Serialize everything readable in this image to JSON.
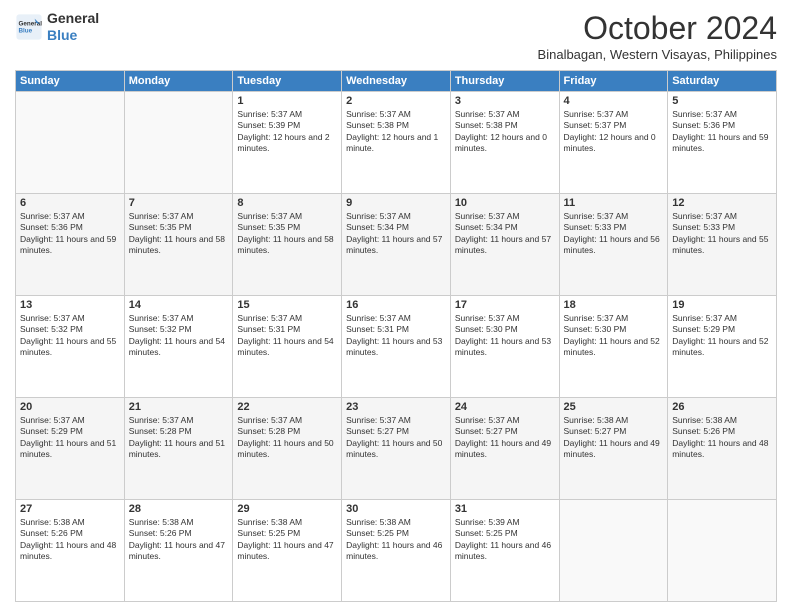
{
  "logo": {
    "line1": "General",
    "line2": "Blue"
  },
  "title": "October 2024",
  "location": "Binalbagan, Western Visayas, Philippines",
  "days_header": [
    "Sunday",
    "Monday",
    "Tuesday",
    "Wednesday",
    "Thursday",
    "Friday",
    "Saturday"
  ],
  "weeks": [
    [
      {
        "day": "",
        "info": ""
      },
      {
        "day": "",
        "info": ""
      },
      {
        "day": "1",
        "sunrise": "5:37 AM",
        "sunset": "5:39 PM",
        "daylight": "12 hours and 2 minutes."
      },
      {
        "day": "2",
        "sunrise": "5:37 AM",
        "sunset": "5:38 PM",
        "daylight": "12 hours and 1 minute."
      },
      {
        "day": "3",
        "sunrise": "5:37 AM",
        "sunset": "5:38 PM",
        "daylight": "12 hours and 0 minutes."
      },
      {
        "day": "4",
        "sunrise": "5:37 AM",
        "sunset": "5:37 PM",
        "daylight": "12 hours and 0 minutes."
      },
      {
        "day": "5",
        "sunrise": "5:37 AM",
        "sunset": "5:36 PM",
        "daylight": "11 hours and 59 minutes."
      }
    ],
    [
      {
        "day": "6",
        "sunrise": "5:37 AM",
        "sunset": "5:36 PM",
        "daylight": "11 hours and 59 minutes."
      },
      {
        "day": "7",
        "sunrise": "5:37 AM",
        "sunset": "5:35 PM",
        "daylight": "11 hours and 58 minutes."
      },
      {
        "day": "8",
        "sunrise": "5:37 AM",
        "sunset": "5:35 PM",
        "daylight": "11 hours and 58 minutes."
      },
      {
        "day": "9",
        "sunrise": "5:37 AM",
        "sunset": "5:34 PM",
        "daylight": "11 hours and 57 minutes."
      },
      {
        "day": "10",
        "sunrise": "5:37 AM",
        "sunset": "5:34 PM",
        "daylight": "11 hours and 57 minutes."
      },
      {
        "day": "11",
        "sunrise": "5:37 AM",
        "sunset": "5:33 PM",
        "daylight": "11 hours and 56 minutes."
      },
      {
        "day": "12",
        "sunrise": "5:37 AM",
        "sunset": "5:33 PM",
        "daylight": "11 hours and 55 minutes."
      }
    ],
    [
      {
        "day": "13",
        "sunrise": "5:37 AM",
        "sunset": "5:32 PM",
        "daylight": "11 hours and 55 minutes."
      },
      {
        "day": "14",
        "sunrise": "5:37 AM",
        "sunset": "5:32 PM",
        "daylight": "11 hours and 54 minutes."
      },
      {
        "day": "15",
        "sunrise": "5:37 AM",
        "sunset": "5:31 PM",
        "daylight": "11 hours and 54 minutes."
      },
      {
        "day": "16",
        "sunrise": "5:37 AM",
        "sunset": "5:31 PM",
        "daylight": "11 hours and 53 minutes."
      },
      {
        "day": "17",
        "sunrise": "5:37 AM",
        "sunset": "5:30 PM",
        "daylight": "11 hours and 53 minutes."
      },
      {
        "day": "18",
        "sunrise": "5:37 AM",
        "sunset": "5:30 PM",
        "daylight": "11 hours and 52 minutes."
      },
      {
        "day": "19",
        "sunrise": "5:37 AM",
        "sunset": "5:29 PM",
        "daylight": "11 hours and 52 minutes."
      }
    ],
    [
      {
        "day": "20",
        "sunrise": "5:37 AM",
        "sunset": "5:29 PM",
        "daylight": "11 hours and 51 minutes."
      },
      {
        "day": "21",
        "sunrise": "5:37 AM",
        "sunset": "5:28 PM",
        "daylight": "11 hours and 51 minutes."
      },
      {
        "day": "22",
        "sunrise": "5:37 AM",
        "sunset": "5:28 PM",
        "daylight": "11 hours and 50 minutes."
      },
      {
        "day": "23",
        "sunrise": "5:37 AM",
        "sunset": "5:27 PM",
        "daylight": "11 hours and 50 minutes."
      },
      {
        "day": "24",
        "sunrise": "5:37 AM",
        "sunset": "5:27 PM",
        "daylight": "11 hours and 49 minutes."
      },
      {
        "day": "25",
        "sunrise": "5:38 AM",
        "sunset": "5:27 PM",
        "daylight": "11 hours and 49 minutes."
      },
      {
        "day": "26",
        "sunrise": "5:38 AM",
        "sunset": "5:26 PM",
        "daylight": "11 hours and 48 minutes."
      }
    ],
    [
      {
        "day": "27",
        "sunrise": "5:38 AM",
        "sunset": "5:26 PM",
        "daylight": "11 hours and 48 minutes."
      },
      {
        "day": "28",
        "sunrise": "5:38 AM",
        "sunset": "5:26 PM",
        "daylight": "11 hours and 47 minutes."
      },
      {
        "day": "29",
        "sunrise": "5:38 AM",
        "sunset": "5:25 PM",
        "daylight": "11 hours and 47 minutes."
      },
      {
        "day": "30",
        "sunrise": "5:38 AM",
        "sunset": "5:25 PM",
        "daylight": "11 hours and 46 minutes."
      },
      {
        "day": "31",
        "sunrise": "5:39 AM",
        "sunset": "5:25 PM",
        "daylight": "11 hours and 46 minutes."
      },
      {
        "day": "",
        "info": ""
      },
      {
        "day": "",
        "info": ""
      }
    ]
  ]
}
